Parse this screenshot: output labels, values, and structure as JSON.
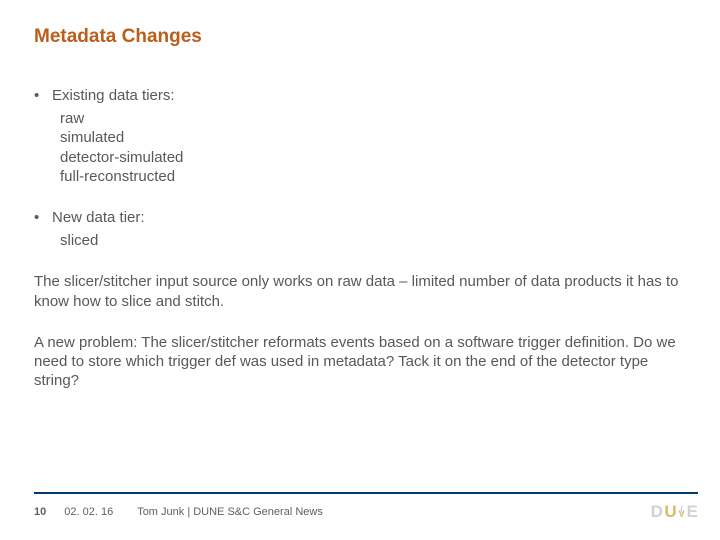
{
  "title": "Metadata Changes",
  "bullets": {
    "b1": "Existing data tiers:",
    "b1s1": "raw",
    "b1s2": "simulated",
    "b1s3": "detector-simulated",
    "b1s4": "full-reconstructed",
    "b2": "New data tier:",
    "b2s1": "sliced"
  },
  "para1": "The slicer/stitcher input source only works on raw data – limited number of data products it has to know how to slice and stitch.",
  "para2": "A new problem:  The slicer/stitcher reformats events based on a software trigger definition.  Do we need to store which trigger def was used in metadata?  Tack it on the end of the detector type string?",
  "footer": {
    "page": "10",
    "date": "02. 02. 16",
    "attribution": "Tom Junk | DUNE S&C General News"
  },
  "logo": {
    "d": "D",
    "u": "U",
    "n": "(",
    "v": "V",
    "e": "E"
  }
}
